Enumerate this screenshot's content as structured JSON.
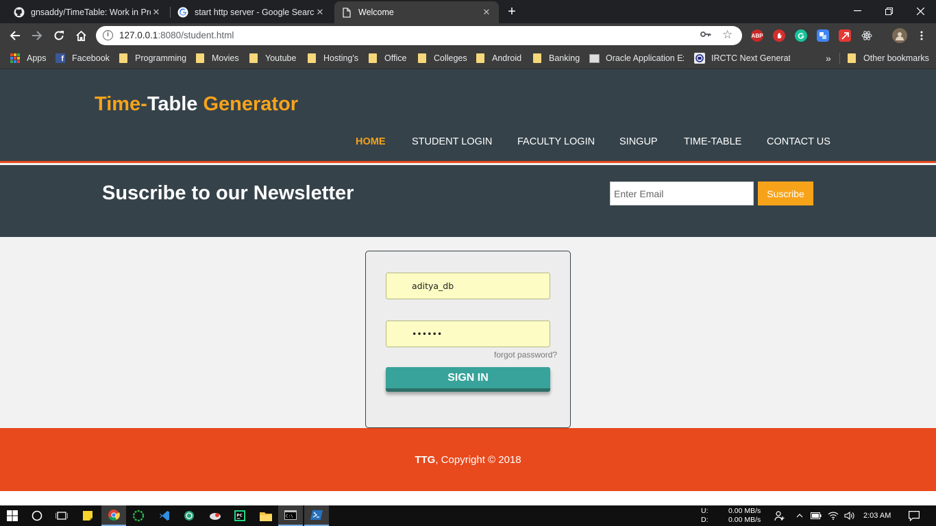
{
  "browser": {
    "tabs": [
      {
        "title": "gnsaddy/TimeTable: Work in Prog",
        "icon": "github-icon",
        "active": false
      },
      {
        "title": "start http server - Google Search",
        "icon": "google-icon",
        "active": false
      },
      {
        "title": "Welcome",
        "icon": "page-icon",
        "active": true
      }
    ],
    "new_tab_label": "+",
    "url_host": "127.0.0.1",
    "url_rest": ":8080/student.html",
    "bookmarks": [
      "Apps",
      "Facebook",
      "Programming",
      "Movies",
      "Youtube",
      "Hosting's",
      "Office",
      "Colleges",
      "Android",
      "Banking",
      "Oracle Application Ex",
      "IRCTC Next Generatio"
    ],
    "bookmarks_overflow": "»",
    "other_bookmarks": "Other bookmarks",
    "extensions": {
      "abp": "ABP"
    }
  },
  "site": {
    "brand": {
      "part1": "Time-",
      "part2": "Table",
      "part3": " Generator"
    },
    "nav": [
      {
        "label": "HOME",
        "current": true
      },
      {
        "label": "STUDENT LOGIN",
        "current": false
      },
      {
        "label": "FACULTY LOGIN",
        "current": false
      },
      {
        "label": "SINGUP",
        "current": false
      },
      {
        "label": "TIME-TABLE",
        "current": false
      },
      {
        "label": "CONTACT US",
        "current": false
      }
    ],
    "newsletter": {
      "title": "Suscribe to our Newsletter",
      "email_placeholder": "Enter Email",
      "button": "Suscribe"
    },
    "login": {
      "username_value": "aditya_db",
      "password_mask": "••••••",
      "forgot": "forgot password?",
      "signin": "SIGN IN"
    },
    "footer": {
      "brand": "TTG",
      "text": ", Copyright © 2018"
    }
  },
  "taskbar": {
    "net_up_label": "U:",
    "net_down_label": "D:",
    "net_up": "0.00 MB/s",
    "net_down": "0.00 MB/s",
    "time": "2:03 AM"
  },
  "colors": {
    "header_bg": "#35424a",
    "accent_orange": "#f7a31a",
    "footer_red": "#e8491d",
    "signin_teal": "#38a39a",
    "input_yellow": "#fcfcc4"
  }
}
